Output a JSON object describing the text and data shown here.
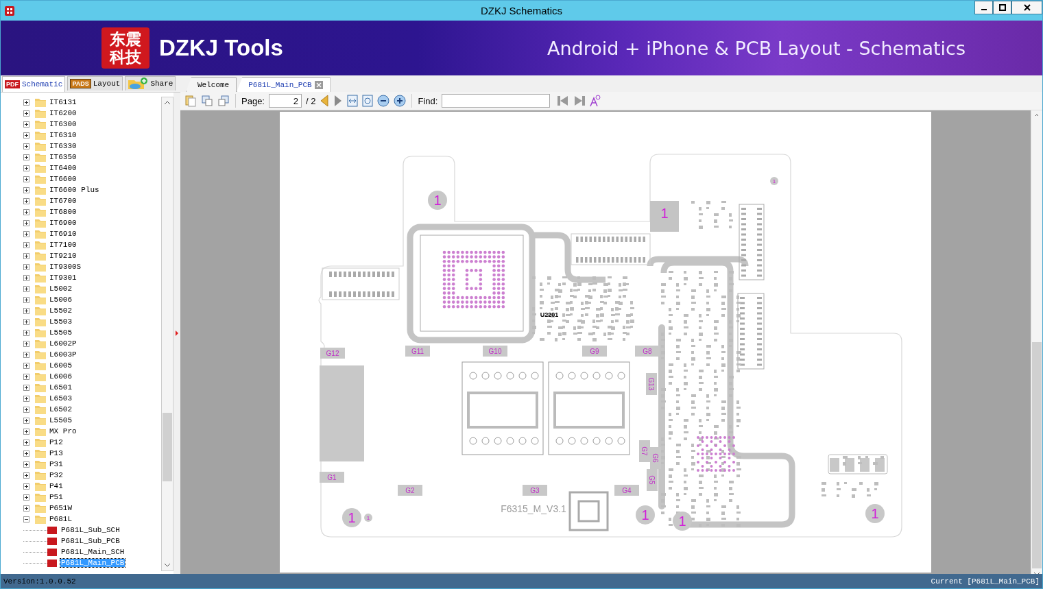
{
  "window": {
    "title": "DZKJ Schematics"
  },
  "banner": {
    "logo_lines": [
      "东震",
      "科技"
    ],
    "title": "DZKJ Tools",
    "tagline": "Android + iPhone & PCB Layout - Schematics"
  },
  "side_tabs": [
    {
      "label": "Schematic",
      "icon_text": "PDF",
      "kind": "pdf",
      "selected": true
    },
    {
      "label": "Layout",
      "icon_text": "PADS",
      "kind": "pads",
      "selected": false
    },
    {
      "label": "Share",
      "kind": "share",
      "selected": false
    }
  ],
  "doc_tabs": [
    {
      "label": "Welcome",
      "selected": false,
      "closable": false
    },
    {
      "label": "P681L_Main_PCB",
      "selected": true,
      "closable": true
    }
  ],
  "toolbar": {
    "page_label": "Page:",
    "page_value": "2",
    "page_total": "/ 2",
    "find_label": "Find:"
  },
  "tree": [
    {
      "label": "IT6131",
      "expanded": false,
      "selected": false
    },
    {
      "label": "IT6200",
      "expanded": false,
      "selected": false
    },
    {
      "label": "IT6300",
      "expanded": false,
      "selected": false
    },
    {
      "label": "IT6310",
      "expanded": false,
      "selected": false
    },
    {
      "label": "IT6330",
      "expanded": false,
      "selected": false
    },
    {
      "label": "IT6350",
      "expanded": false,
      "selected": false
    },
    {
      "label": "IT6400",
      "expanded": false,
      "selected": false
    },
    {
      "label": "IT6600",
      "expanded": false,
      "selected": false
    },
    {
      "label": "IT6600 Plus",
      "expanded": false,
      "selected": false
    },
    {
      "label": "IT6700",
      "expanded": false,
      "selected": false
    },
    {
      "label": "IT6800",
      "expanded": false,
      "selected": false
    },
    {
      "label": "IT6900",
      "expanded": false,
      "selected": false
    },
    {
      "label": "IT6910",
      "expanded": false,
      "selected": false
    },
    {
      "label": "IT7100",
      "expanded": false,
      "selected": false
    },
    {
      "label": "IT9210",
      "expanded": false,
      "selected": false
    },
    {
      "label": "IT9300S",
      "expanded": false,
      "selected": false
    },
    {
      "label": "IT9301",
      "expanded": false,
      "selected": false
    },
    {
      "label": "L5002",
      "expanded": false,
      "selected": false
    },
    {
      "label": "L5006",
      "expanded": false,
      "selected": false
    },
    {
      "label": "L5502",
      "expanded": false,
      "selected": false
    },
    {
      "label": "L5503",
      "expanded": false,
      "selected": false
    },
    {
      "label": "L5505",
      "expanded": false,
      "selected": false
    },
    {
      "label": "L6002P",
      "expanded": false,
      "selected": false
    },
    {
      "label": "L6003P",
      "expanded": false,
      "selected": false
    },
    {
      "label": "L6005",
      "expanded": false,
      "selected": false
    },
    {
      "label": "L6006",
      "expanded": false,
      "selected": false
    },
    {
      "label": "L6501",
      "expanded": false,
      "selected": false
    },
    {
      "label": "L6503",
      "expanded": false,
      "selected": false
    },
    {
      "label": "L6502",
      "expanded": false,
      "selected": false
    },
    {
      "label": "L5505",
      "expanded": false,
      "selected": false
    },
    {
      "label": "MX Pro",
      "expanded": false,
      "selected": false
    },
    {
      "label": "P12",
      "expanded": false,
      "selected": false
    },
    {
      "label": "P13",
      "expanded": false,
      "selected": false
    },
    {
      "label": "P31",
      "expanded": false,
      "selected": false
    },
    {
      "label": "P32",
      "expanded": false,
      "selected": false
    },
    {
      "label": "P41",
      "expanded": false,
      "selected": false
    },
    {
      "label": "P51",
      "expanded": false,
      "selected": false
    },
    {
      "label": "P651W",
      "expanded": false,
      "selected": false
    },
    {
      "label": "P681L",
      "expanded": true,
      "selected": false,
      "children": [
        {
          "label": "P681L_Sub_SCH",
          "selected": false
        },
        {
          "label": "P681L_Sub_PCB",
          "selected": false
        },
        {
          "label": "P681L_Main_SCH",
          "selected": false
        },
        {
          "label": "P681L_Main_PCB",
          "selected": true
        }
      ]
    }
  ],
  "board": {
    "labels": [
      "G12",
      "G11",
      "G10",
      "G9",
      "G8",
      "G13",
      "G7",
      "G6",
      "G1",
      "G5",
      "G2",
      "G3",
      "G4"
    ],
    "markers": [
      "1",
      "1",
      "1",
      "1",
      "1",
      "1",
      "1",
      "1"
    ],
    "version_text": "F6315_M_V3.1",
    "chip_label": "U2201"
  },
  "status_bar": {
    "version": "Version:1.0.0.52",
    "current": "Current [P681L_Main_PCB]"
  }
}
